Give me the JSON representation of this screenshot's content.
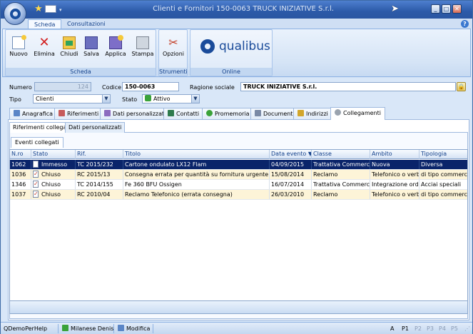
{
  "window": {
    "title": "Clienti e Fornitori 150-0063 TRUCK INIZIATIVE S.r.l."
  },
  "ribbon": {
    "tabs": [
      "Scheda",
      "Consultazioni"
    ],
    "groups": {
      "scheda": {
        "label": "Scheda",
        "buttons": [
          "Nuovo",
          "Elimina",
          "Chiudi",
          "Salva",
          "Applica",
          "Stampa"
        ]
      },
      "strumenti": {
        "label": "Strumenti",
        "buttons": [
          "Opzioni"
        ]
      },
      "online": {
        "label": "Online",
        "logo_text": "qualibus"
      }
    }
  },
  "form": {
    "numero_label": "Numero",
    "numero_value": "124",
    "codice_label": "Codice",
    "codice_value": "150-0063",
    "ragione_label": "Ragione sociale",
    "ragione_value": "TRUCK INIZIATIVE S.r.l.",
    "tipo_label": "Tipo",
    "tipo_value": "Clienti",
    "stato_label": "Stato",
    "stato_value": "Attivo"
  },
  "main_tabs": [
    "Anagrafica",
    "Riferimenti",
    "Dati personalizzati",
    "Contatti",
    "Promemoria",
    "Documenti",
    "Indirizzi",
    "Collegamenti"
  ],
  "sub_tabs": [
    "Riferimenti collegati",
    "Dati personalizzati"
  ],
  "events_tab": "Eventi collegati",
  "grid": {
    "columns": [
      "N.ro",
      "Stato",
      "Rif.",
      "Titolo",
      "Data evento",
      "Classe",
      "Ambito",
      "Tipologia"
    ],
    "rows": [
      [
        "1062",
        "Immesso",
        "TC 2015/232",
        "Cartone ondulato LX12 Flam",
        "04/09/2015",
        "Trattativa Commerciale",
        "Nuova",
        "Diversa"
      ],
      [
        "1036",
        "Chiuso",
        "RC 2015/13",
        "Consegna errata per quantità su fornitura urgente",
        "15/08/2014",
        "Reclamo",
        "Telefonico o verbale",
        "di tipo commerciale"
      ],
      [
        "1346",
        "Chiuso",
        "TC 2014/155",
        "Fe 360 BFU Ossigen",
        "16/07/2014",
        "Trattativa Commerciale",
        "Integrazione ordine",
        "Acciai speciali"
      ],
      [
        "1037",
        "Chiuso",
        "RC 2010/04",
        "Reclamo Telefonico (errata consegna)",
        "26/03/2010",
        "Reclamo",
        "Telefonico o verbale",
        "di tipo commerciale"
      ]
    ]
  },
  "statusbar": {
    "items": [
      "QDemoPerHelp",
      "Milanese Denis",
      "Modifica"
    ],
    "pages": [
      "A",
      "P1",
      "P2",
      "P3",
      "P4",
      "P5"
    ]
  },
  "colors": {
    "title_bar": "#2c5aa8",
    "selected_row": "#0a246a",
    "alt_row": "#fdf4d8",
    "brand": "#1a4b9a"
  }
}
